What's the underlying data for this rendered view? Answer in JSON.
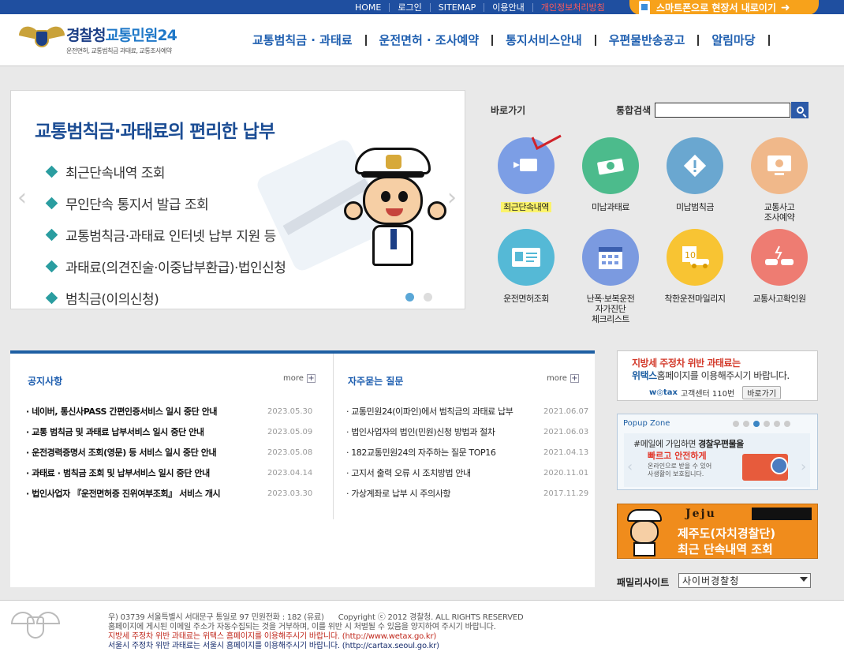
{
  "topbar": {
    "links": [
      "HOME",
      "로그인",
      "SITEMAP",
      "이용안내",
      "개인정보처리방침"
    ],
    "smart_button": "스마트폰으로 현장서 내로이기"
  },
  "header": {
    "logo_main": "경찰청",
    "logo_accent": "교통민원24",
    "logo_sub": "운전면허, 교통범칙금 과태료, 교통조사예약",
    "nav": [
      "교통범칙금 · 과태료",
      "운전면허 · 조사예약",
      "통지서비스안내",
      "우편물반송공고",
      "알림마당"
    ]
  },
  "banner": {
    "headline": "교통범칙금·과태료의 편리한 납부",
    "items": [
      "최근단속내역 조회",
      "무인단속 통지서 발급 조회",
      "교통범칙금·과태료 인터넷 납부 지원 등",
      "과태료(의견진술·이중납부환급)·법인신청",
      "범칙금(이의신청)"
    ],
    "prev": "‹",
    "next": "›"
  },
  "quick": {
    "title": "바로가기",
    "search_label": "통합검색",
    "search_value": "",
    "items": [
      {
        "label": "최근단속내역",
        "color": "#7c9ee5"
      },
      {
        "label": "미납과태료",
        "color": "#4cbb8c"
      },
      {
        "label": "미납범칙금",
        "color": "#6aa7d0"
      },
      {
        "label": "교통사고\n조사예약",
        "color": "#f0b88a"
      },
      {
        "label": "운전면허조회",
        "color": "#55b9d6"
      },
      {
        "label": "난폭·보복운전\n자가진단\n체크리스트",
        "color": "#7b9ae0"
      },
      {
        "label": "착한운전마일리지",
        "color": "#f8c433"
      },
      {
        "label": "교통사고확인원",
        "color": "#ee7c72"
      }
    ]
  },
  "notice": {
    "title": "공지사항",
    "more": "more",
    "rows": [
      {
        "t": "네이버, 통신사PASS 간편인증서비스 일시 중단 안내",
        "d": "2023.05.30"
      },
      {
        "t": "교통 범칙금 및 과태료 납부서비스 일시 중단 안내",
        "d": "2023.05.09"
      },
      {
        "t": "운전경력증명서 조회(영문) 등 서비스 일시 중단 안내",
        "d": "2023.05.08"
      },
      {
        "t": "과태료 · 범칙금 조회 및 납부서비스 일시 중단 안내",
        "d": "2023.04.14"
      },
      {
        "t": "법인사업자 『운전면허증 진위여부조회』 서비스 개시",
        "d": "2023.03.30"
      }
    ]
  },
  "faq": {
    "title": "자주묻는 질문",
    "more": "more",
    "rows": [
      {
        "t": "교통민원24(이파인)에서 범칙금의 과태료 납부",
        "d": "2021.06.07"
      },
      {
        "t": "법인사업자의 법인(민원)신청 방법과 절차",
        "d": "2021.06.03"
      },
      {
        "t": "182교통민원24의 자주하는 질문 TOP16",
        "d": "2021.04.13"
      },
      {
        "t": "고지서 출력 오류 시 조치방법 안내",
        "d": "2020.11.01"
      },
      {
        "t": "가상계좌로 납부 시 주의사항",
        "d": "2017.11.29"
      }
    ]
  },
  "side": {
    "wetax_line1": "지방세 주정차 위반 과태료는",
    "wetax_line2_brand": "위택스",
    "wetax_line2_rest": "홈페이지를 이용해주시기 바랍니다.",
    "wetax_logo": "w◎tax",
    "wetax_center": "고객센터 110번",
    "wetax_btn": "바로가기",
    "popup_title": "Popup Zone",
    "popup_m1_pre": "#메일에 가입하면",
    "popup_m1_bold": "경찰우편물을",
    "popup_m2": "빠르고 안전하게",
    "popup_m3": "온라인으로 받을 수 있어 사생활이 보호됩니다.",
    "jeju_logo": "Jeju",
    "jeju_l1": "제주도(자치경찰단)",
    "jeju_l2": "최근 단속내역 조회",
    "family_label": "패밀리사이트",
    "family_value": "사이버경찰청"
  },
  "footer": {
    "addr": "우) 03739 서울특별시 서대문구 통일로 97   민원전화 : 182 (유료)",
    "copy": "Copyright ⓒ 2012 경찰청. ALL RIGHTS RESERVED",
    "line2": "홈페이지에 게시된 이메일 주소가 자동수집되는 것을 거부하며, 이를 위반 시 처벌될 수 있음을 양지하여 주시기 바랍니다.",
    "line3": "지방세 주정차 위반 과태료는 위택스 홈페이지를 이용해주시기 바랍니다. (http://www.wetax.go.kr)",
    "line4": "서울시 주정차 위반 과태료는 서울시 홈페이지를 이용해주시기 바랍니다. (http://cartax.seoul.go.kr)"
  }
}
